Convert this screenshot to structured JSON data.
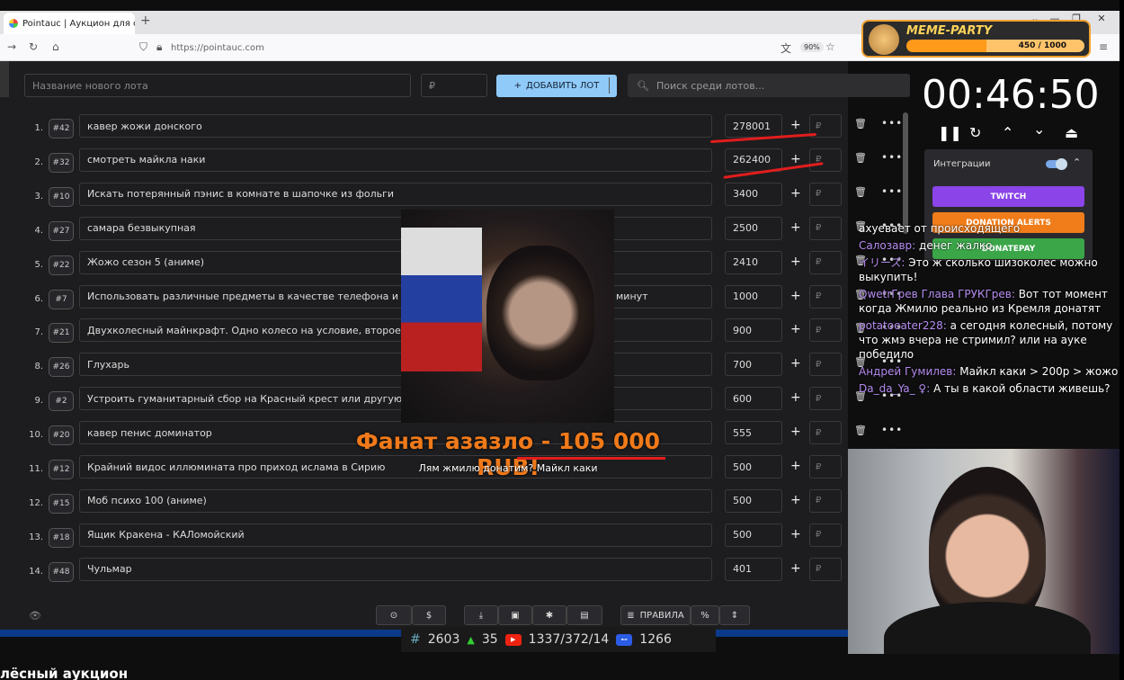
{
  "browser": {
    "tab_title": "Pointauc | Аукцион для стриме",
    "url": "https://pointauc.com",
    "zoom": "90%"
  },
  "toolbar": {
    "new_lot_placeholder": "Название нового лота",
    "price_placeholder": "₽",
    "add_button": "ДОБАВИТЬ ЛОТ",
    "search_placeholder": "Поиск среди лотов..."
  },
  "lots": [
    {
      "n": "1.",
      "id": "#42",
      "name": "кавер жожи донского",
      "amount": "278001"
    },
    {
      "n": "2.",
      "id": "#32",
      "name": "смотреть майкла наки",
      "amount": "262400"
    },
    {
      "n": "3.",
      "id": "#10",
      "name": "Искать потерянный пэнис в комнате в шапочке из фольги",
      "amount": "3400"
    },
    {
      "n": "4.",
      "id": "#27",
      "name": "самара безвыкупная",
      "amount": "2500"
    },
    {
      "n": "5.",
      "id": "#22",
      "name": "Жожо сезон 5 (аниме)",
      "amount": "2410"
    },
    {
      "n": "6.",
      "id": "#7",
      "name": "Использовать различные предметы в качестве телефона и общать",
      "tail": "минут",
      "amount": "1000"
    },
    {
      "n": "7.",
      "id": "#21",
      "name": "Двухколесный майнкрафт. Одно колесо на условие, второе на нака",
      "amount": "900"
    },
    {
      "n": "8.",
      "id": "#26",
      "name": "Глухарь",
      "amount": "700"
    },
    {
      "n": "9.",
      "id": "#2",
      "name": "Устроить гуманитарный сбор на Красный крест или другую невоен",
      "amount": "600"
    },
    {
      "n": "10.",
      "id": "#20",
      "name": "кавер пенис доминатор",
      "amount": "555"
    },
    {
      "n": "11.",
      "id": "#12",
      "name": "Крайний видос иллюмината про приход ислама в Сирию",
      "amount": "500"
    },
    {
      "n": "12.",
      "id": "#15",
      "name": "Моб психо 100 (аниме)",
      "amount": "500"
    },
    {
      "n": "13.",
      "id": "#18",
      "name": "Ящик Кракена - КАЛомойский",
      "amount": "500"
    },
    {
      "n": "14.",
      "id": "#48",
      "name": "Чульмар",
      "amount": "401"
    }
  ],
  "rub_sign": "₽",
  "alert": {
    "title_prefix": "Фанат азазло - ",
    "title_amount": "105 000 RUB!",
    "message": "Лям жмилю донатим? Майкл каки"
  },
  "bottom_toolbar": {
    "rules": "ПРАВИЛА"
  },
  "stats": {
    "a": "2603",
    "b": "35",
    "c": "1337/372/14",
    "d": "1266"
  },
  "page_heading": "лёсный аукцион",
  "meme_party": {
    "title": "MEME-PARTY",
    "progress": "450 / 1000",
    "progress_fraction": 0.45
  },
  "timer": "00:46:50",
  "integrations": {
    "label": "Интеграции",
    "twitch": "TWITCH",
    "donation_alerts": "DONATION ALERTS",
    "donatepay": "DONATEPAY"
  },
  "chat": [
    {
      "user": "",
      "text": "ахуевает от происходящего"
    },
    {
      "user": "Салозавр:",
      "text": "денег жалко"
    },
    {
      "user": "イリーズ:",
      "text": "Это ж сколько шизоколес можно выкупить!"
    },
    {
      "user": "QwetrГрев Глава ГРУКГрев:",
      "text": "Вот тот момент когда Жмилю реально из Кремля донатят"
    },
    {
      "user": "potatoeater228:",
      "text": "а сегодня колесный, потому что жмэ вчера не стримил? или на ауке победило"
    },
    {
      "user": "Андрей Гумилев:",
      "text": "Майкл каки > 200р > жожо"
    },
    {
      "user": "Da_da_Ya_ ♀:",
      "text": "А ты в какой области живешь?"
    }
  ]
}
